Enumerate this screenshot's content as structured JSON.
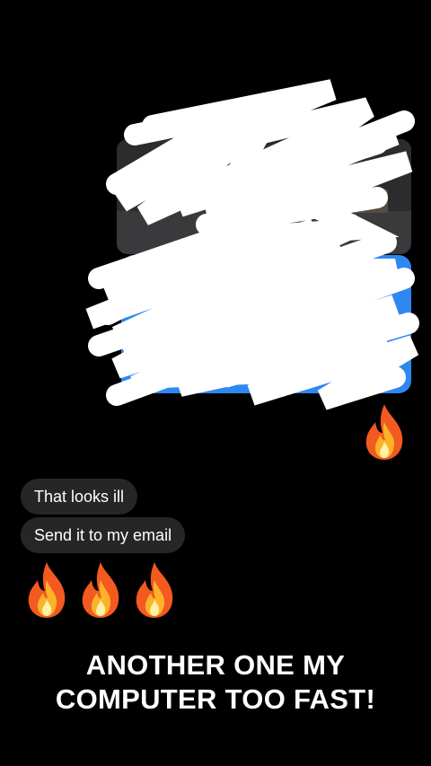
{
  "messages": {
    "items": [
      {
        "text": "That looks ill"
      },
      {
        "text": "Send it to my email"
      }
    ]
  },
  "caption": {
    "line1": "ANOTHER ONE MY",
    "line2": "COMPUTER TOO FAST!"
  },
  "reaction_emoji": "fire-icon",
  "colors": {
    "background": "#000000",
    "bubble": "#262628",
    "blue_card": "#2f87f0",
    "gray_card": "#3a3a3c",
    "scribble": "#ffffff"
  }
}
